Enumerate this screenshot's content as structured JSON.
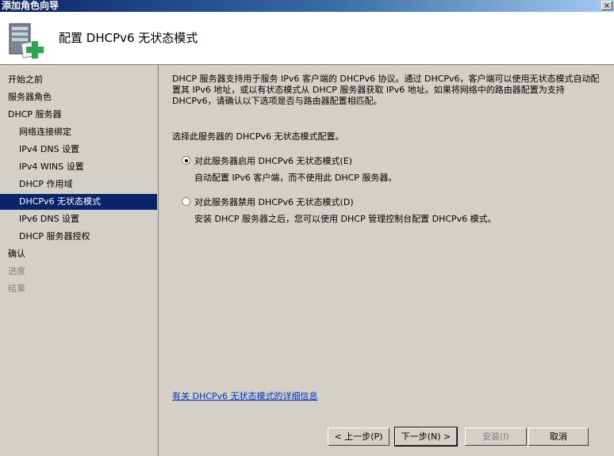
{
  "window": {
    "title": "添加角色向导",
    "close_glyph": "×"
  },
  "header": {
    "title": "配置 DHCPv6 无状态模式",
    "icon": "server-role-add-icon"
  },
  "sidebar": {
    "items": [
      {
        "label": "开始之前"
      },
      {
        "label": "服务器角色"
      },
      {
        "label": "DHCP 服务器"
      },
      {
        "label": "网络连接绑定"
      },
      {
        "label": "IPv4 DNS 设置"
      },
      {
        "label": "IPv4 WINS 设置"
      },
      {
        "label": "DHCP 作用域"
      },
      {
        "label": "DHCPv6 无状态模式"
      },
      {
        "label": "IPv6 DNS 设置"
      },
      {
        "label": "DHCP 服务器授权"
      },
      {
        "label": "确认"
      },
      {
        "label": "进度"
      },
      {
        "label": "结果"
      }
    ]
  },
  "main": {
    "description": "DHCP 服务器支持用于服务 IPv6 客户端的 DHCPv6 协议。通过 DHCPv6，客户端可以使用无状态模式自动配置其 IPv6 地址，或以有状态模式从 DHCP 服务器获取 IPv6 地址。如果将网络中的路由器配置为支持 DHCPv6，请确认以下选项是否与路由器配置相匹配。",
    "prompt": "选择此服务器的 DHCPv6 无状态模式配置。",
    "options": [
      {
        "label": "对此服务器启用 DHCPv6 无状态模式(E)",
        "description": "自动配置 IPv6 客户端，而不使用此 DHCP 服务器。",
        "selected": true
      },
      {
        "label": "对此服务器禁用 DHCPv6 无状态模式(D)",
        "description": "安装 DHCP 服务器之后，您可以使用 DHCP 管理控制台配置 DHCPv6 模式。",
        "selected": false
      }
    ],
    "more_info_link": "有关 DHCPv6 无状态模式的详细信息"
  },
  "buttons": {
    "back": "< 上一步(P)",
    "next": "下一步(N) >",
    "install": "安装(I)",
    "cancel": "取消"
  },
  "colors": {
    "selection": "#0a246a",
    "titlebar": "#0a246a",
    "link": "#0033cc",
    "face": "#d4d0c8"
  }
}
